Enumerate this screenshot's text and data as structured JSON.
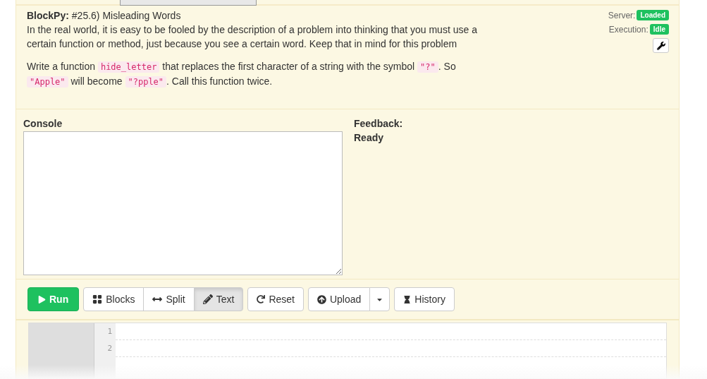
{
  "header": {
    "brand": "BlockPy:",
    "title": "#25.6) Misleading Words",
    "intro": "In the real world, it is easy to be fooled by the description of a problem into thinking that you must use a certain function or method, just because you see a certain word. Keep that in mind for this problem",
    "instructions": [
      {
        "kind": "text",
        "text": "Write a function "
      },
      {
        "kind": "code",
        "text": "hide_letter"
      },
      {
        "kind": "text",
        "text": " that replaces the first character of a string with the symbol "
      },
      {
        "kind": "code",
        "text": "\"?\""
      },
      {
        "kind": "text",
        "text": ". So "
      },
      {
        "kind": "code",
        "text": "\"Apple\""
      },
      {
        "kind": "text",
        "text": " will become "
      },
      {
        "kind": "code",
        "text": "\"?pple\""
      },
      {
        "kind": "text",
        "text": ". Call this function twice."
      }
    ]
  },
  "status": [
    {
      "label": "Server:",
      "value": "Loaded"
    },
    {
      "label": "Execution:",
      "value": "Idle"
    }
  ],
  "console": {
    "label": "Console"
  },
  "feedback": {
    "label": "Feedback:",
    "message": "Ready"
  },
  "toolbar": {
    "run": "Run",
    "modes": [
      {
        "label": "Blocks",
        "selected": false
      },
      {
        "label": "Split",
        "selected": false
      },
      {
        "label": "Text",
        "selected": true
      }
    ],
    "reset": "Reset",
    "upload": "Upload",
    "history": "History"
  },
  "editor": {
    "line_numbers": [
      "1",
      "2"
    ]
  }
}
